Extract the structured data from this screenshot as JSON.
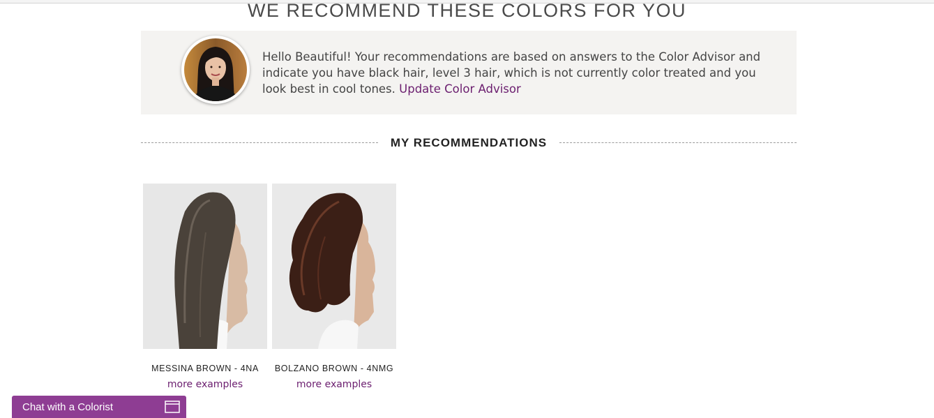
{
  "page": {
    "title": "WE RECOMMEND THESE COLORS FOR YOU"
  },
  "advisor": {
    "message": "Hello Beautiful! Your recommendations are based on answers to the Color Advisor and indicate you have black hair, level 3 hair, which is not currently color treated and you look best in cool tones.",
    "link_label": "Update Color Advisor",
    "avatar_icon": "colorist-portrait"
  },
  "recommendations": {
    "heading": "MY RECOMMENDATIONS",
    "items": [
      {
        "name": "MESSINA BROWN - 4NA",
        "link_label": "more examples",
        "hair_color": "#4a423a"
      },
      {
        "name": "BOLZANO BROWN - 4NMG",
        "link_label": "more examples",
        "hair_color": "#3b1f16"
      }
    ]
  },
  "chat": {
    "label": "Chat with a Colorist",
    "icon": "window-icon",
    "color": "#8e3d93"
  },
  "colors": {
    "accent_link": "#6b1e6f",
    "panel_bg": "#f4f3f1"
  }
}
